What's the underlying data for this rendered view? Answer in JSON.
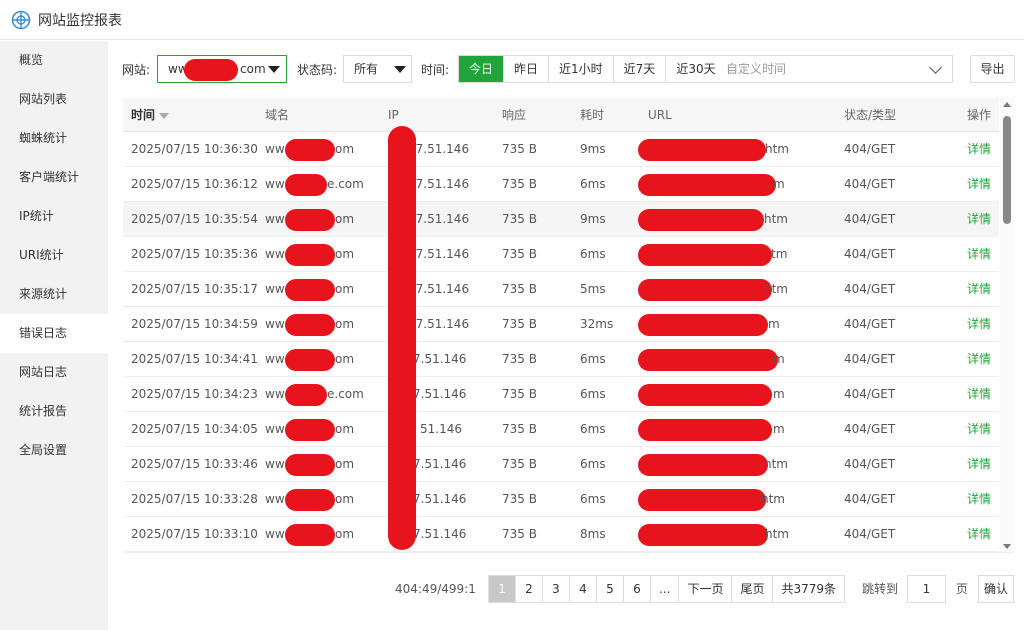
{
  "app": {
    "title": "网站监控报表",
    "accent": "#20a53a",
    "redaction_color": "#e8141c"
  },
  "sidebar": {
    "items": [
      {
        "label": "概览"
      },
      {
        "label": "网站列表"
      },
      {
        "label": "蜘蛛统计"
      },
      {
        "label": "客户端统计"
      },
      {
        "label": "IP统计"
      },
      {
        "label": "URI统计"
      },
      {
        "label": "来源统计"
      },
      {
        "label": "错误日志",
        "active": true
      },
      {
        "label": "网站日志"
      },
      {
        "label": "统计报告"
      },
      {
        "label": "全局设置"
      }
    ]
  },
  "filters": {
    "site_label": "网站:",
    "site_prefix": "ww",
    "site_suffix": "com",
    "status_label": "状态码:",
    "status_value": "所有",
    "time_label": "时间:",
    "time_tabs": [
      {
        "label": "今日",
        "active": true
      },
      {
        "label": "昨日"
      },
      {
        "label": "近1小时"
      },
      {
        "label": "近7天"
      },
      {
        "label": "近30天"
      }
    ],
    "custom_time_placeholder": "自定义时间",
    "export_label": "导出"
  },
  "table": {
    "columns": [
      "时间",
      "域名",
      "IP",
      "响应",
      "耗时",
      "URL",
      "状态/类型",
      "操作"
    ],
    "rows": [
      {
        "time": "2025/07/15 10:36:30",
        "domain_a": "ww",
        "domain_b": "om",
        "ip": "27.51.146",
        "resp": "735 B",
        "cost": "9ms",
        "url_tail": "htm",
        "status": "404/GET",
        "action": "详情"
      },
      {
        "time": "2025/07/15 10:36:12",
        "domain_a": "ww",
        "domain_b": "e.com",
        "ip": "27.51.146",
        "resp": "735 B",
        "cost": "6ms",
        "url_tail": "m",
        "status": "404/GET",
        "action": "详情"
      },
      {
        "time": "2025/07/15 10:35:54",
        "domain_a": "ww",
        "domain_b": "om",
        "ip": "27.51.146",
        "resp": "735 B",
        "cost": "9ms",
        "url_tail": "htm",
        "status": "404/GET",
        "action": "详情"
      },
      {
        "time": "2025/07/15 10:35:36",
        "domain_a": "ww",
        "domain_b": "om",
        "ip": "27.51.146",
        "resp": "735 B",
        "cost": "6ms",
        "url_tail": "tm",
        "status": "404/GET",
        "action": "详情"
      },
      {
        "time": "2025/07/15 10:35:17",
        "domain_a": "ww",
        "domain_b": "om",
        "ip": "27.51.146",
        "resp": "735 B",
        "cost": "5ms",
        "url_tail": "htm",
        "status": "404/GET",
        "action": "详情"
      },
      {
        "time": "2025/07/15 10:34:59",
        "domain_a": "ww",
        "domain_b": "om",
        "ip": "27.51.146",
        "resp": "735 B",
        "cost": "32ms",
        "url_tail": "m",
        "status": "404/GET",
        "action": "详情"
      },
      {
        "time": "2025/07/15 10:34:41",
        "domain_a": "ww",
        "domain_b": "om",
        "ip": "7.51.146",
        "resp": "735 B",
        "cost": "6ms",
        "url_tail": "m",
        "status": "404/GET",
        "action": "详情"
      },
      {
        "time": "2025/07/15 10:34:23",
        "domain_a": "ww",
        "domain_b": "e.com",
        "ip": "7.51.146",
        "resp": "735 B",
        "cost": "6ms",
        "url_tail": "m",
        "status": "404/GET",
        "action": "详情"
      },
      {
        "time": "2025/07/15 10:34:05",
        "domain_a": "ww",
        "domain_b": "om",
        "ip": "51.146",
        "resp": "735 B",
        "cost": "6ms",
        "url_tail": "m",
        "status": "404/GET",
        "action": "详情"
      },
      {
        "time": "2025/07/15 10:33:46",
        "domain_a": "ww",
        "domain_b": "om",
        "ip": "7.51.146",
        "resp": "735 B",
        "cost": "6ms",
        "url_tail": "htm",
        "status": "404/GET",
        "action": "详情"
      },
      {
        "time": "2025/07/15 10:33:28",
        "domain_a": "ww",
        "domain_b": "om",
        "ip": "7.51.146",
        "resp": "735 B",
        "cost": "6ms",
        "url_tail": "htm",
        "status": "404/GET",
        "action": "详情"
      },
      {
        "time": "2025/07/15 10:33:10",
        "domain_a": "ww",
        "domain_b": "om",
        "ip": "7.51.146",
        "resp": "735 B",
        "cost": "8ms",
        "url_tail": "htm",
        "status": "404/GET",
        "action": "详情"
      }
    ]
  },
  "pagination": {
    "stat": "404:49/499:1",
    "pages": [
      "1",
      "2",
      "3",
      "4",
      "5",
      "6",
      "..."
    ],
    "next": "下一页",
    "last": "尾页",
    "total": "共3779条",
    "jump_label": "跳转到",
    "jump_value": "1",
    "page_unit": "页",
    "confirm": "确认"
  }
}
